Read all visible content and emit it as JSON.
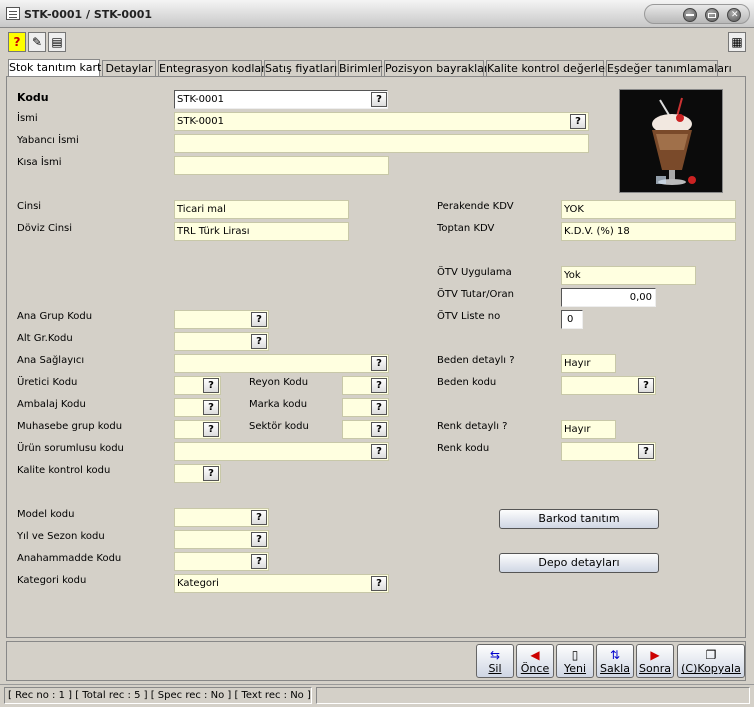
{
  "window": {
    "title": "STK-0001 / STK-0001"
  },
  "toolbar": {
    "help": "?"
  },
  "tabs": [
    {
      "label": "Stok tanıtım kartı"
    },
    {
      "label": "Detaylar"
    },
    {
      "label": "Entegrasyon kodları"
    },
    {
      "label": "Satış fiyatları"
    },
    {
      "label": "Birimler"
    },
    {
      "label": "Pozisyon bayrakları"
    },
    {
      "label": "Kalite kontrol değerleri"
    },
    {
      "label": "Eşdeğer tanımlamaları"
    }
  ],
  "form": {
    "kodu": {
      "label": "Kodu",
      "value": "STK-0001"
    },
    "ismi": {
      "label": "İsmi",
      "value": "STK-0001"
    },
    "yabanci_ismi": {
      "label": "Yabancı İsmi",
      "value": ""
    },
    "kisa_ismi": {
      "label": "Kısa İsmi",
      "value": ""
    },
    "cinsi": {
      "label": "Cinsi",
      "value": "Ticari mal"
    },
    "doviz_cinsi": {
      "label": "Döviz Cinsi",
      "value": "TRL Türk Lirası"
    },
    "perakende_kdv": {
      "label": "Perakende KDV",
      "value": "YOK"
    },
    "toptan_kdv": {
      "label": "Toptan KDV",
      "value": "K.D.V. (%) 18"
    },
    "otv_uygulama": {
      "label": "ÖTV Uygulama",
      "value": "Yok"
    },
    "otv_tutar": {
      "label": "ÖTV Tutar/Oran",
      "value": "0,00"
    },
    "otv_liste": {
      "label": "ÖTV Liste no",
      "value": "0"
    },
    "ana_grup": {
      "label": "Ana Grup Kodu",
      "value": ""
    },
    "alt_grup": {
      "label": "Alt Gr.Kodu",
      "value": ""
    },
    "ana_saglayici": {
      "label": "Ana Sağlayıcı",
      "value": ""
    },
    "uretici": {
      "label": "Üretici Kodu",
      "value": ""
    },
    "reyon": {
      "label": "Reyon Kodu",
      "value": ""
    },
    "ambalaj": {
      "label": "Ambalaj Kodu",
      "value": ""
    },
    "marka": {
      "label": "Marka kodu",
      "value": ""
    },
    "muhasebe": {
      "label": "Muhasebe grup kodu",
      "value": ""
    },
    "sektor": {
      "label": "Sektör kodu",
      "value": ""
    },
    "urun_sorumlusu": {
      "label": "Ürün sorumlusu kodu",
      "value": ""
    },
    "kalite_kontrol": {
      "label": "Kalite kontrol kodu",
      "value": ""
    },
    "beden_detayli": {
      "label": "Beden detaylı ?",
      "value": "Hayır"
    },
    "beden_kodu": {
      "label": "Beden kodu",
      "value": ""
    },
    "renk_detayli": {
      "label": "Renk detaylı ?",
      "value": "Hayır"
    },
    "renk_kodu": {
      "label": "Renk kodu",
      "value": ""
    },
    "model": {
      "label": "Model kodu",
      "value": ""
    },
    "yil_sezon": {
      "label": "Yıl ve Sezon kodu",
      "value": ""
    },
    "anahammadde": {
      "label": "Anahammadde Kodu",
      "value": ""
    },
    "kategori": {
      "label": "Kategori kodu",
      "value": "Kategori"
    }
  },
  "buttons": {
    "barkod": "Barkod tanıtım",
    "depo": "Depo detayları"
  },
  "nav": {
    "sil": "Sil",
    "once": "Önce",
    "yeni": "Yeni",
    "sakla": "Sakla",
    "sonra": "Sonra",
    "kopyala": "(C)Kopyala"
  },
  "status": {
    "rec_info": "[ Rec no : 1 ] [ Total rec : 5 ] [ Spec rec : No ] [ Text rec : No ]"
  },
  "colors": {
    "field_bg": "#ffffe0",
    "window_bg": "#d4d0c8"
  }
}
